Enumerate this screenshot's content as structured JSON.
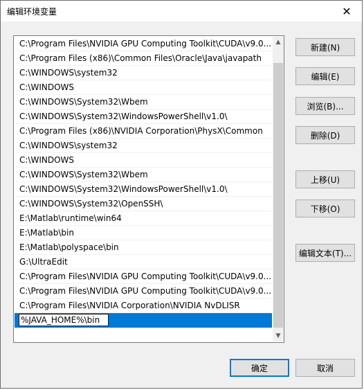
{
  "window": {
    "title": "编辑环境变量",
    "close_glyph": "✕"
  },
  "list": {
    "items": [
      "C:\\Program Files\\NVIDIA GPU Computing Toolkit\\CUDA\\v9.0...",
      "C:\\Program Files (x86)\\Common Files\\Oracle\\Java\\javapath",
      "C:\\WINDOWS\\system32",
      "C:\\WINDOWS",
      "C:\\WINDOWS\\System32\\Wbem",
      "C:\\WINDOWS\\System32\\WindowsPowerShell\\v1.0\\",
      "C:\\Program Files (x86)\\NVIDIA Corporation\\PhysX\\Common",
      "C:\\WINDOWS\\system32",
      "C:\\WINDOWS",
      "C:\\WINDOWS\\System32\\Wbem",
      "C:\\WINDOWS\\System32\\WindowsPowerShell\\v1.0\\",
      "C:\\WINDOWS\\System32\\OpenSSH\\",
      "E:\\Matlab\\runtime\\win64",
      "E:\\Matlab\\bin",
      "E:\\Matlab\\polyspace\\bin",
      "G:\\UltraEdit",
      "C:\\Program Files\\NVIDIA GPU Computing Toolkit\\CUDA\\v9.0...",
      "C:\\Program Files\\NVIDIA GPU Computing Toolkit\\CUDA\\v9.0...",
      "C:\\Program Files\\NVIDIA Corporation\\NVIDIA NvDLISR"
    ],
    "editing_value": "%JAVA_HOME%\\bin"
  },
  "buttons": {
    "new": "新建(N)",
    "edit": "编辑(E)",
    "browse": "浏览(B)...",
    "delete": "删除(D)",
    "move_up": "上移(U)",
    "move_down": "下移(O)",
    "edit_text": "编辑文本(T)...",
    "ok": "确定",
    "cancel": "取消"
  },
  "icons": {
    "scroll_up": "chevron-up-icon",
    "scroll_down": "chevron-down-icon"
  },
  "colors": {
    "selection": "#0078d7"
  }
}
